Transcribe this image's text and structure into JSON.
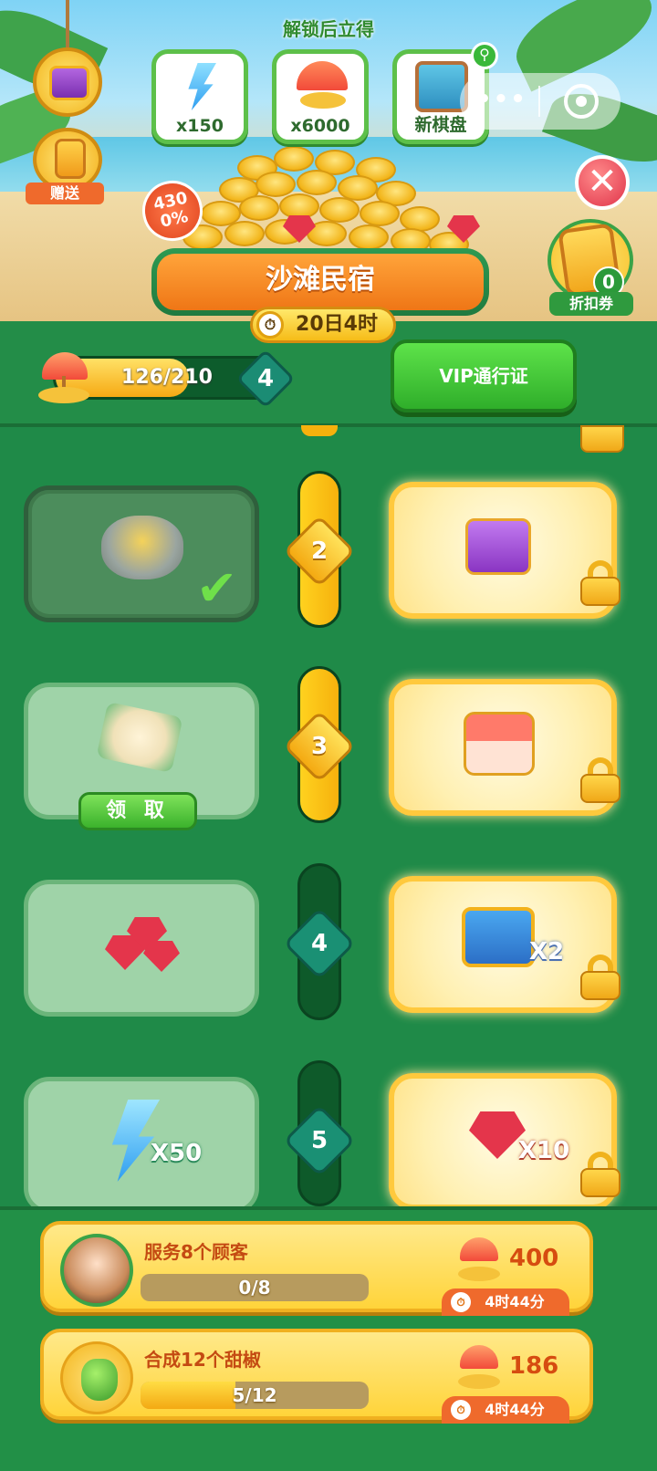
{
  "header": {
    "unlock_title": "解锁后立得",
    "rewards": [
      {
        "icon": "energy-bolt-icon",
        "label": "x150"
      },
      {
        "icon": "beach-umbrella-icon",
        "label": "x6000"
      },
      {
        "icon": "new-board-icon",
        "label": "新棋盘"
      }
    ],
    "gift_label": "赠送",
    "bonus_badge": "4300%",
    "discount_count": "0",
    "discount_label": "折扣券",
    "event_title": "沙滩民宿",
    "event_timer": "20日4时"
  },
  "progress": {
    "text": "126/210",
    "current": 126,
    "total": 210,
    "level": "4",
    "vip_button": "VIP通行证"
  },
  "rows": [
    {
      "level": "2",
      "free_state": "claimed",
      "free_icon": "soup-pot-icon",
      "vip_icon": "purple-chest-icon",
      "vip_mult": ""
    },
    {
      "level": "3",
      "free_state": "claimable",
      "free_icon": "fried-rice-icon",
      "claim_label": "领 取",
      "vip_icon": "red-mystery-chest-icon",
      "vip_mult": ""
    },
    {
      "level": "4",
      "free_state": "locked",
      "free_icon": "ruby-gems-icon",
      "vip_icon": "blue-chest-icon",
      "vip_mult": "X2"
    },
    {
      "level": "5",
      "free_state": "locked",
      "free_icon": "energy-bolt-icon",
      "free_mult": "X50",
      "vip_icon": "ruby-icon",
      "vip_mult": "X10"
    }
  ],
  "tasks": [
    {
      "title": "服务8个顾客",
      "progress_text": "0/8",
      "progress": 0,
      "reward": "400",
      "timer": "4时44分",
      "icon": "girl-avatar-icon"
    },
    {
      "title": "合成12个甜椒",
      "progress_text": "5/12",
      "progress": 0.4167,
      "reward": "186",
      "timer": "4时44分",
      "icon": "green-pepper-icon"
    }
  ],
  "colors": {
    "background_green": "#1f8a48",
    "gold": "#ffd43a",
    "orange_banner": "#ef7616",
    "vip_green": "#2fae2a"
  }
}
